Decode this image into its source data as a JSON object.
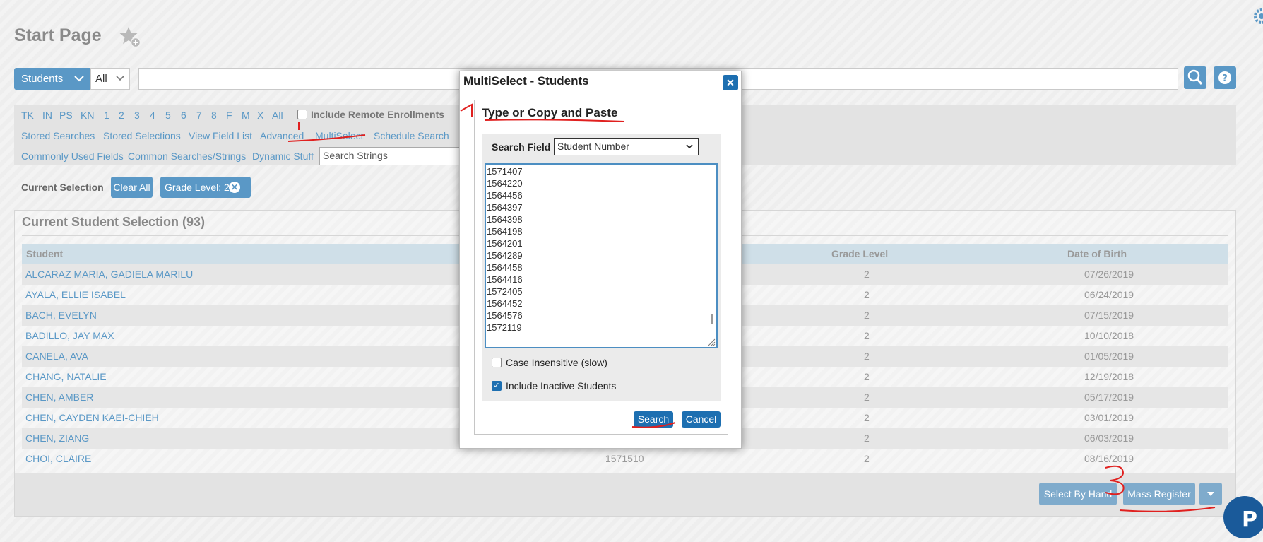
{
  "page": {
    "title": "Start Page"
  },
  "search": {
    "scope": "Students",
    "subscope": "All",
    "placeholder": ""
  },
  "filters": {
    "grades": [
      "TK",
      "IN",
      "PS",
      "KN",
      "1",
      "2",
      "3",
      "4",
      "5",
      "6",
      "7",
      "8",
      "F",
      "M",
      "X",
      "All"
    ],
    "include_remote": "Include Remote Enrollments",
    "links_row2": [
      "Stored Searches",
      "Stored Selections",
      "View Field List",
      "Advanced",
      "MultiSelect",
      "Schedule Search"
    ],
    "links_row3": [
      "Commonly Used Fields",
      "Common Searches/Strings",
      "Dynamic Stuff"
    ],
    "strings_placeholder": "Search Strings"
  },
  "current_selection": {
    "label": "Current Selection",
    "clear_label": "Clear All",
    "chip": "Grade Level: 2"
  },
  "selection": {
    "heading": "Current Student Selection (93)",
    "columns": {
      "student": "Student",
      "grade": "Grade Level",
      "dob": "Date of Birth"
    },
    "rows": [
      {
        "name": "ALCARAZ MARIA, GADIELA MARILU",
        "number": "",
        "grade": "2",
        "dob": "07/26/2019"
      },
      {
        "name": "AYALA, ELLIE ISABEL",
        "number": "",
        "grade": "2",
        "dob": "06/24/2019"
      },
      {
        "name": "BACH, EVELYN",
        "number": "",
        "grade": "2",
        "dob": "07/15/2019"
      },
      {
        "name": "BADILLO, JAY MAX",
        "number": "",
        "grade": "2",
        "dob": "10/10/2018"
      },
      {
        "name": "CANELA, AVA",
        "number": "",
        "grade": "2",
        "dob": "01/05/2019"
      },
      {
        "name": "CHANG, NATALIE",
        "number": "",
        "grade": "2",
        "dob": "12/19/2018"
      },
      {
        "name": "CHEN, AMBER",
        "number": "",
        "grade": "2",
        "dob": "05/17/2019"
      },
      {
        "name": "CHEN, CAYDEN KAEI-CHIEH",
        "number": "",
        "grade": "2",
        "dob": "03/01/2019"
      },
      {
        "name": "CHEN, ZIANG",
        "number": "",
        "grade": "2",
        "dob": "06/03/2019"
      },
      {
        "name": "CHOI, CLAIRE",
        "number": "1571510",
        "grade": "2",
        "dob": "08/16/2019"
      }
    ],
    "buttons": {
      "select_by_hand": "Select By Hand",
      "mass_register": "Mass Register"
    }
  },
  "modal": {
    "title": "MultiSelect - Students",
    "heading": "Type or Copy and Paste",
    "field_label": "Search Field",
    "field_value": "Student Number",
    "numbers": [
      "1571407",
      "1564220",
      "1564456",
      "1564397",
      "1564398",
      "1564198",
      "1564201",
      "1564289",
      "1564458",
      "1564416",
      "1572405",
      "1564452",
      "1564576",
      "1572119"
    ],
    "case_insensitive": "Case Insensitive (slow)",
    "include_inactive": "Include Inactive Students",
    "search_label": "Search",
    "cancel_label": "Cancel"
  },
  "colors": {
    "accent": "#5a98c6",
    "modal_button": "#1d6fb1",
    "annotation": "#e0201f"
  },
  "icons": [
    "star-add-icon",
    "gear-icon",
    "chevron-down-icon",
    "magnify-icon",
    "help-icon",
    "close-icon",
    "caret-down-icon",
    "powerschool-logo-icon"
  ]
}
